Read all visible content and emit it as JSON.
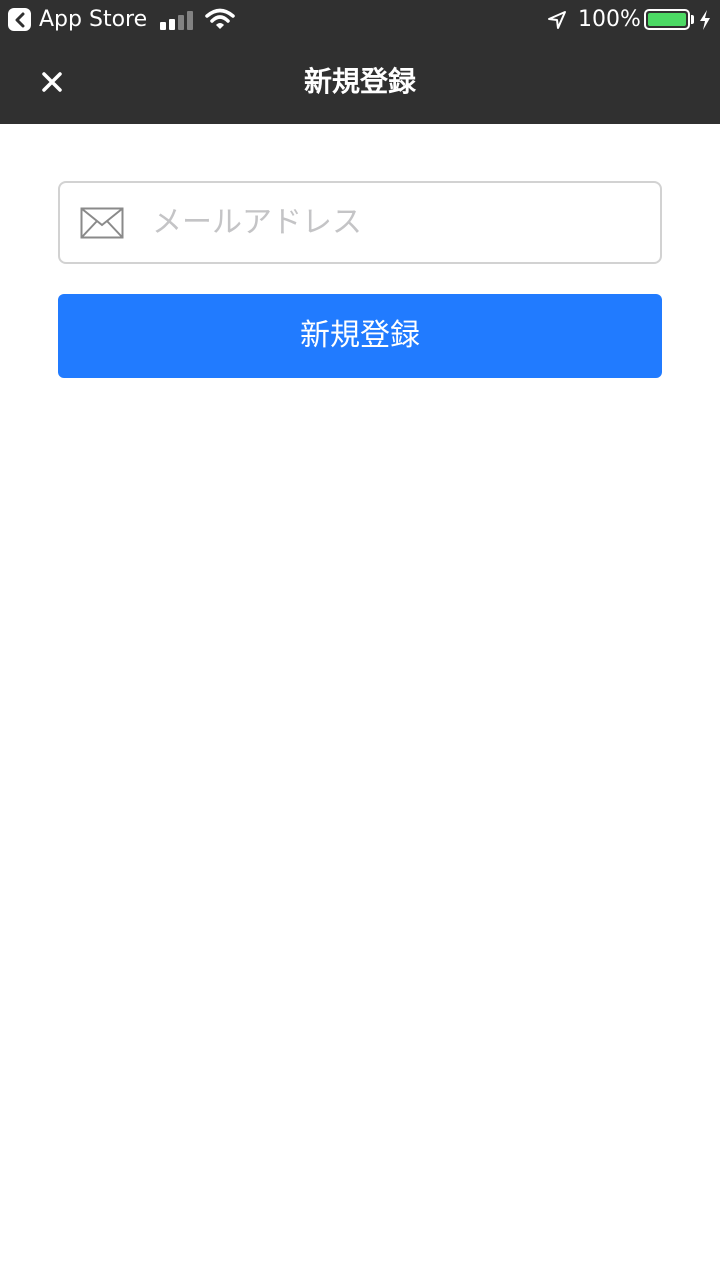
{
  "status_bar": {
    "back_app_label": "App Store",
    "battery_percent_text": "100%",
    "battery_level": 1.0,
    "signal_bars_filled": 2,
    "signal_bars_total": 4,
    "icons": [
      "back-chevron-icon",
      "signal-icon",
      "wifi-icon",
      "location-arrow-icon",
      "battery-icon",
      "charging-bolt-icon"
    ]
  },
  "nav": {
    "title": "新規登録",
    "close_icon": "close-icon"
  },
  "form": {
    "email_icon": "mail-icon",
    "email_value": "",
    "email_placeholder": "メールアドレス",
    "submit_label": "新規登録"
  },
  "colors": {
    "bar_background": "#303030",
    "primary_button": "#217bff",
    "battery_fill": "#4cd964",
    "input_border": "#d2d2d2",
    "placeholder": "#c4c4c6"
  }
}
